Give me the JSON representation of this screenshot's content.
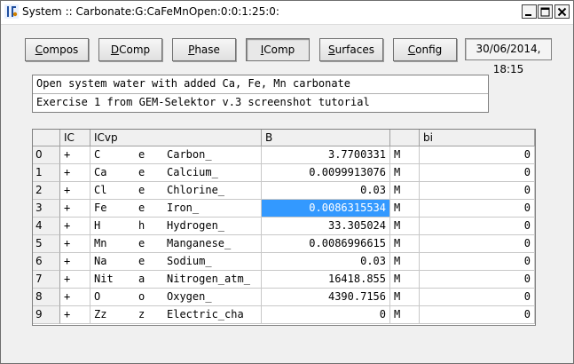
{
  "window": {
    "title": "System :: Carbonate:G:CaFeMnOpen:0:0:1:25:0:"
  },
  "toolbar": {
    "buttons": [
      {
        "key": "compos",
        "label": "Compos",
        "accel": "C",
        "rest": "ompos"
      },
      {
        "key": "dcomp",
        "label": "DComp",
        "accel": "D",
        "rest": "Comp"
      },
      {
        "key": "phase",
        "label": "Phase",
        "accel": "P",
        "rest": "hase"
      },
      {
        "key": "icomp",
        "label": "IComp",
        "accel": "I",
        "rest": "Comp"
      },
      {
        "key": "surfaces",
        "label": "Surfaces",
        "accel": "S",
        "rest": "urfaces"
      },
      {
        "key": "config",
        "label": "Config",
        "accel": "C",
        "rest": "onfig"
      }
    ],
    "active": "IComp",
    "datetime": "30/06/2014, 18:15"
  },
  "notes": {
    "line1": "Open system water with added Ca, Fe, Mn carbonate",
    "line2": "Exercise 1 from GEM-Selektor v.3 screenshot tutorial"
  },
  "table": {
    "headers": {
      "ic": "IC",
      "icvp": "ICvp",
      "b": "B",
      "unit": "",
      "bi": "bi"
    },
    "rows": [
      {
        "idx": "0",
        "ic": "+",
        "sym": "C",
        "type": "e",
        "name": "Carbon_",
        "b": "3.7700331",
        "unit": "M",
        "bi": "0"
      },
      {
        "idx": "1",
        "ic": "+",
        "sym": "Ca",
        "type": "e",
        "name": "Calcium_",
        "b": "0.0099913076",
        "unit": "M",
        "bi": "0"
      },
      {
        "idx": "2",
        "ic": "+",
        "sym": "Cl",
        "type": "e",
        "name": "Chlorine_",
        "b": "0.03",
        "unit": "M",
        "bi": "0"
      },
      {
        "idx": "3",
        "ic": "+",
        "sym": "Fe",
        "type": "e",
        "name": "Iron_",
        "b": "0.0086315534",
        "unit": "M",
        "bi": "0",
        "selected": true
      },
      {
        "idx": "4",
        "ic": "+",
        "sym": "H",
        "type": "h",
        "name": "Hydrogen_",
        "b": "33.305024",
        "unit": "M",
        "bi": "0"
      },
      {
        "idx": "5",
        "ic": "+",
        "sym": "Mn",
        "type": "e",
        "name": "Manganese_",
        "b": "0.0086996615",
        "unit": "M",
        "bi": "0"
      },
      {
        "idx": "6",
        "ic": "+",
        "sym": "Na",
        "type": "e",
        "name": "Sodium_",
        "b": "0.03",
        "unit": "M",
        "bi": "0"
      },
      {
        "idx": "7",
        "ic": "+",
        "sym": "Nit",
        "type": "a",
        "name": "Nitrogen_atm_",
        "b": "16418.855",
        "unit": "M",
        "bi": "0"
      },
      {
        "idx": "8",
        "ic": "+",
        "sym": "O",
        "type": "o",
        "name": "Oxygen_",
        "b": "4390.7156",
        "unit": "M",
        "bi": "0"
      },
      {
        "idx": "9",
        "ic": "+",
        "sym": "Zz",
        "type": "z",
        "name": "Electric_cha",
        "b": "0",
        "unit": "M",
        "bi": "0"
      }
    ]
  },
  "colors": {
    "selection": "#3399ff",
    "window_bg": "#f0f0f0"
  }
}
